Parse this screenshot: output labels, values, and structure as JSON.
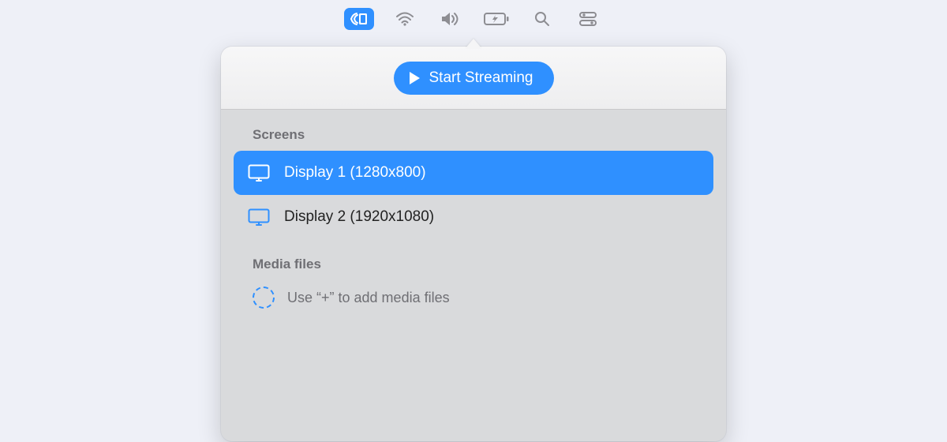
{
  "colors": {
    "accent": "#2f90ff",
    "muted": "#6f6f74"
  },
  "menubar": {
    "items": [
      {
        "name": "streaming-icon",
        "active": true
      },
      {
        "name": "wifi-icon",
        "active": false
      },
      {
        "name": "volume-icon",
        "active": false
      },
      {
        "name": "battery-charging-icon",
        "active": false
      },
      {
        "name": "search-icon",
        "active": false
      },
      {
        "name": "control-center-icon",
        "active": false
      }
    ]
  },
  "popover": {
    "start_button": "Start Streaming",
    "sections": {
      "screens_label": "Screens",
      "media_label": "Media files"
    },
    "screens": [
      {
        "label": "Display 1 (1280x800)",
        "selected": true
      },
      {
        "label": "Display 2 (1920x1080)",
        "selected": false
      }
    ],
    "media_placeholder": "Use “+” to add media files"
  }
}
